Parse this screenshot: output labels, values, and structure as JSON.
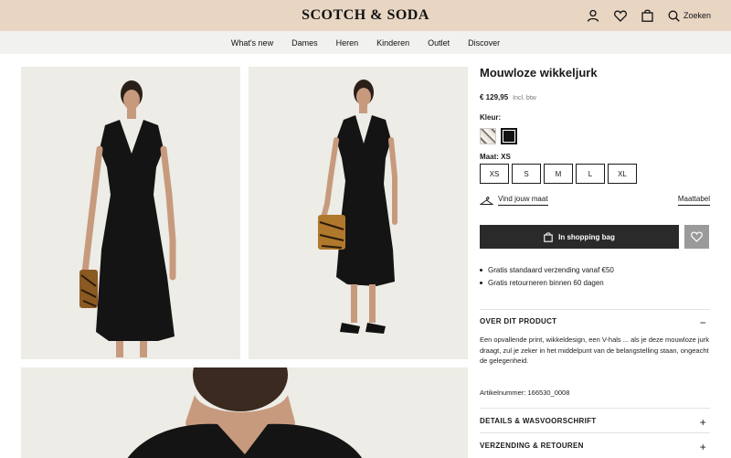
{
  "header": {
    "logo": "SCOTCH & SODA",
    "search_label": "Zoeken"
  },
  "nav": {
    "items": [
      "What's new",
      "Dames",
      "Heren",
      "Kinderen",
      "Outlet",
      "Discover"
    ]
  },
  "product": {
    "title": "Mouwloze wikkeljurk",
    "price": "€ 129,95",
    "price_note": "Incl. btw",
    "color_label": "Kleur:",
    "size_label": "Maat:",
    "selected_size": "XS",
    "sizes": [
      "XS",
      "S",
      "M",
      "L",
      "XL"
    ],
    "fit_link": "Vind jouw maat",
    "size_chart": "Maattabel",
    "add_to_bag": "In shopping bag",
    "perks": [
      "Gratis standaard verzending vanaf €50",
      "Gratis retourneren binnen 60 dagen"
    ],
    "about_heading": "OVER DIT PRODUCT",
    "about_toggle": "−",
    "description": "Een opvallende print, wikkeldesign, een V-hals ... als je deze mouwloze jurk draagt, zul je zeker in het middelpunt van de belangstelling staan, ongeacht de gelegenheid.",
    "article_number": "Artikelnummer: 166530_0008",
    "details_heading": "DETAILS & WASVOORSCHRIFT",
    "details_toggle": "+",
    "shipping_heading": "VERZENDING & RETOUREN",
    "shipping_toggle": "+"
  },
  "colors": {
    "header_bg": "#e8d6c3",
    "nav_bg": "#f1f1ef",
    "button_dark": "#2a2a2a",
    "wishlist_bg": "#9a9a9a",
    "photo_bg": "#edece6"
  }
}
